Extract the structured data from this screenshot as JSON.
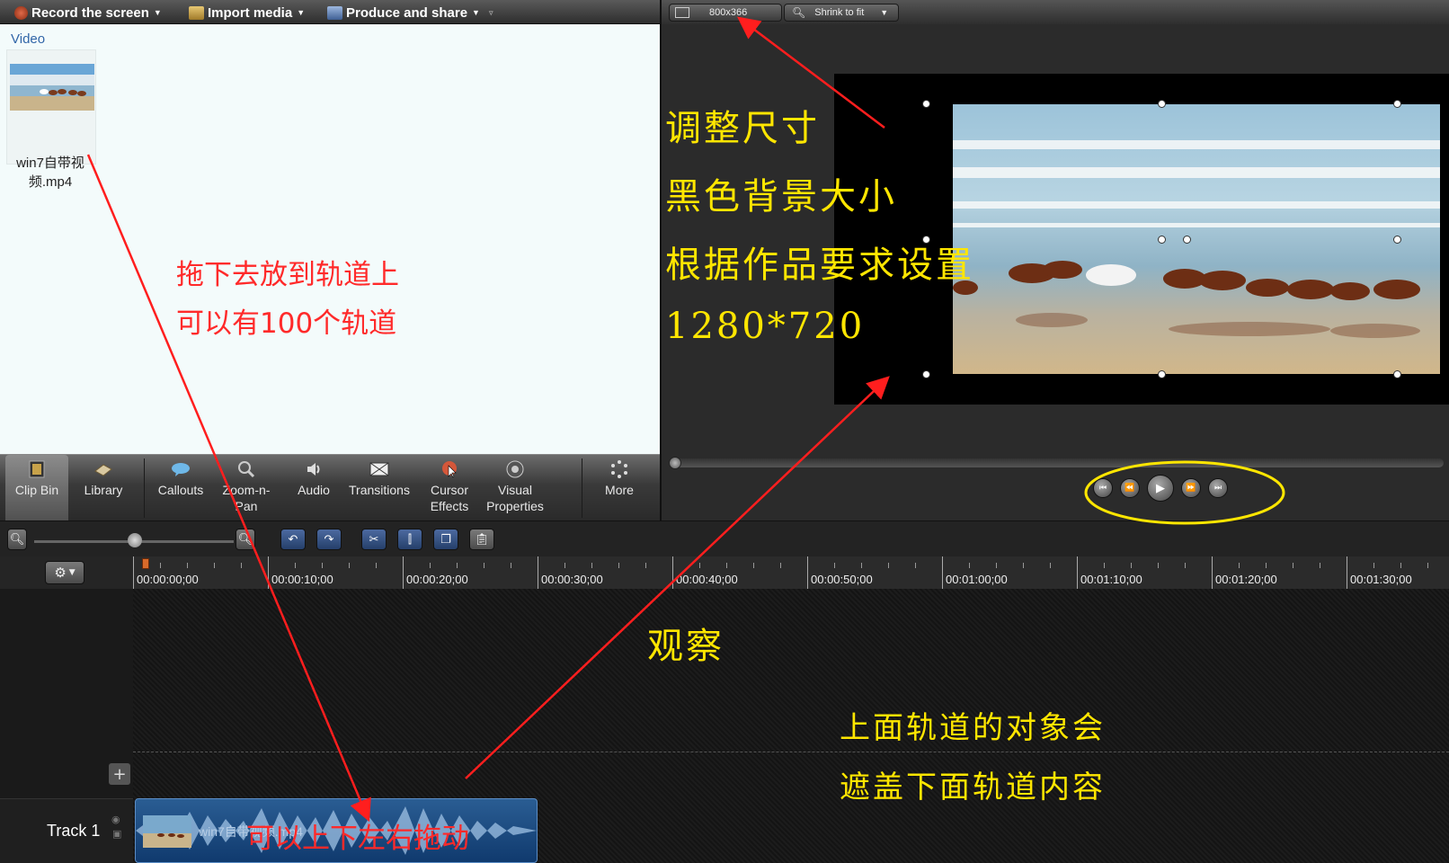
{
  "menu": {
    "record": "Record the screen",
    "import": "Import media",
    "produce": "Produce and share"
  },
  "clip_bin": {
    "heading": "Video",
    "media_name": "win7自带视频.mp4"
  },
  "tool_tabs": [
    {
      "label": "Clip Bin",
      "icon": "film-icon"
    },
    {
      "label": "Library",
      "icon": "library-icon"
    },
    {
      "label": "Callouts",
      "icon": "callout-icon"
    },
    {
      "label": "Zoom-n-Pan",
      "icon": "zoom-icon"
    },
    {
      "label": "Audio",
      "icon": "speaker-icon"
    },
    {
      "label": "Transitions",
      "icon": "transition-icon"
    },
    {
      "label": "Cursor Effects",
      "icon": "cursor-icon"
    },
    {
      "label": "Visual Properties",
      "icon": "visual-icon"
    },
    {
      "label": "More",
      "icon": "more-icon"
    }
  ],
  "preview": {
    "size": "800x366",
    "fit": "Shrink to fit"
  },
  "timeline": {
    "ticks": [
      "00:00:00;00",
      "00:00:10;00",
      "00:00:20;00",
      "00:00:30;00",
      "00:00:40;00",
      "00:00:50;00",
      "00:01:00;00",
      "00:01:10;00",
      "00:01:20;00",
      "00:01:30;00"
    ],
    "track_label": "Track 1",
    "clip_label": "win7自带视频.mp4"
  },
  "annotations": {
    "drag_1": "拖下去放到轨道上",
    "drag_2": "可以有100个轨道",
    "resize": "调整尺寸",
    "bg_1": "黑色背景大小",
    "bg_2": "根据作品要求设置",
    "resolution": "1280*720",
    "observe": "观察",
    "cover_1": "上面轨道的对象会",
    "cover_2": "遮盖下面轨道内容",
    "move": "可以上下左右拖动"
  },
  "colors": {
    "annotation_red": "#ff2a2a",
    "annotation_yellow": "#ffe600",
    "clip_blue": "#1e4f86"
  }
}
